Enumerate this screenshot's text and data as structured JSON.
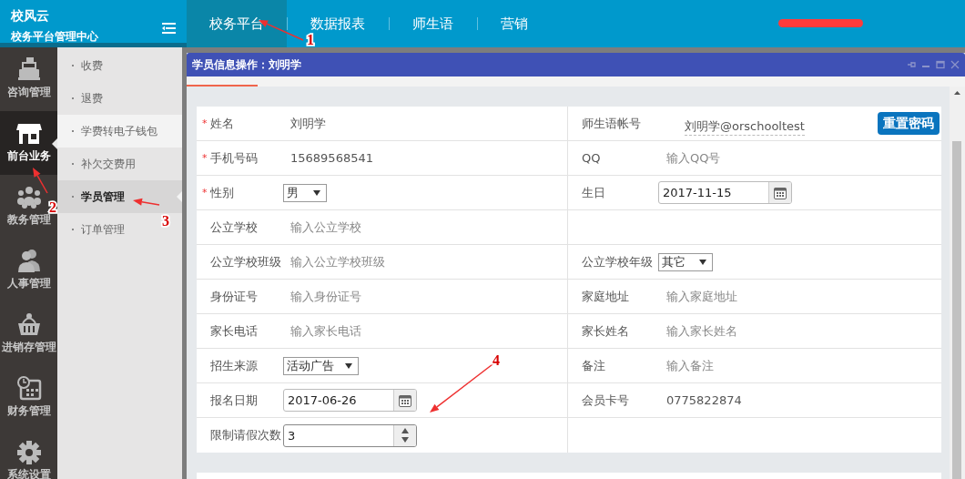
{
  "header": {
    "brand": "校风云",
    "subtitle": "校务平台管理中心",
    "nav": [
      {
        "label": "校务平台",
        "selected": true
      },
      {
        "label": "数据报表",
        "selected": false
      },
      {
        "label": "师生语",
        "selected": false
      },
      {
        "label": "营销",
        "selected": false
      }
    ]
  },
  "sidebar": {
    "items": [
      {
        "label": "咨询管理",
        "selected": false
      },
      {
        "label": "前台业务",
        "selected": true
      },
      {
        "label": "教务管理",
        "selected": false
      },
      {
        "label": "人事管理",
        "selected": false
      },
      {
        "label": "进销存管理",
        "selected": false
      },
      {
        "label": "财务管理",
        "selected": false
      },
      {
        "label": "系统设置",
        "selected": false
      }
    ]
  },
  "submenu": {
    "items": [
      {
        "label": "收费",
        "selected": false,
        "hovered": false
      },
      {
        "label": "退费",
        "selected": false,
        "hovered": false
      },
      {
        "label": "学费转电子钱包",
        "selected": false,
        "hovered": true
      },
      {
        "label": "补欠交费用",
        "selected": false,
        "hovered": false
      },
      {
        "label": "学员管理",
        "selected": true,
        "hovered": false
      },
      {
        "label": "订单管理",
        "selected": false,
        "hovered": false
      }
    ]
  },
  "dialog": {
    "title": "学员信息操作：刘明学",
    "left_fields": [
      {
        "kind": "text",
        "required_mark": "*",
        "label": "姓名",
        "value": "刘明学"
      },
      {
        "kind": "text",
        "required_mark": "*",
        "label": "手机号码",
        "value": "15689568541"
      },
      {
        "kind": "select",
        "required_mark": "*",
        "label": "性别",
        "value": "男"
      },
      {
        "kind": "input",
        "label": "公立学校",
        "placeholder": "输入公立学校"
      },
      {
        "kind": "input",
        "label": "公立学校班级",
        "placeholder": "输入公立学校班级"
      },
      {
        "kind": "input",
        "label": "身份证号",
        "placeholder": "输入身份证号"
      },
      {
        "kind": "input",
        "label": "家长电话",
        "placeholder": "输入家长电话"
      },
      {
        "kind": "select",
        "label": "招生来源",
        "value": "活动广告"
      },
      {
        "kind": "date",
        "label": "报名日期",
        "value": "2017-06-26"
      },
      {
        "kind": "number",
        "label": "限制请假次数",
        "value": "3"
      }
    ],
    "right_fields": [
      {
        "kind": "account",
        "label": "师生语帐号",
        "value": "刘明学@orschooltest",
        "button": "重置密码"
      },
      {
        "kind": "input",
        "label": "QQ",
        "placeholder": "输入QQ号"
      },
      {
        "kind": "date",
        "label": "生日",
        "value": "2017-11-15"
      },
      {
        "kind": "empty"
      },
      {
        "kind": "select",
        "label": "公立学校年级",
        "value": "其它"
      },
      {
        "kind": "input",
        "label": "家庭地址",
        "placeholder": "输入家庭地址"
      },
      {
        "kind": "input",
        "label": "家长姓名",
        "placeholder": "输入家长姓名"
      },
      {
        "kind": "input",
        "label": "备注",
        "placeholder": "输入备注"
      },
      {
        "kind": "text",
        "label": "会员卡号",
        "value": "0775822874"
      },
      {
        "kind": "empty"
      }
    ]
  },
  "annotations": [
    {
      "label": "1"
    },
    {
      "label": "2"
    },
    {
      "label": "3"
    },
    {
      "label": "4"
    }
  ]
}
